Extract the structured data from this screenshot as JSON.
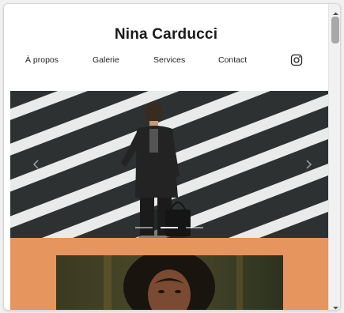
{
  "site": {
    "title": "Nina Carducci"
  },
  "nav": {
    "items": [
      {
        "label": "À propos"
      },
      {
        "label": "Galerie"
      },
      {
        "label": "Services"
      },
      {
        "label": "Contact"
      }
    ],
    "social_icon": "instagram-icon"
  },
  "hero": {
    "image": "businessman-crossing-crosswalk",
    "slides": 3,
    "active_slide": 2,
    "prev_icon": "chevron-left-icon",
    "next_icon": "chevron-right-icon"
  },
  "about": {
    "background_color": "#e6955f",
    "portrait": "woman-portrait"
  },
  "colors": {
    "accent": "#e6955f",
    "text": "#1a1a1a",
    "page_bg": "#ffffff"
  }
}
